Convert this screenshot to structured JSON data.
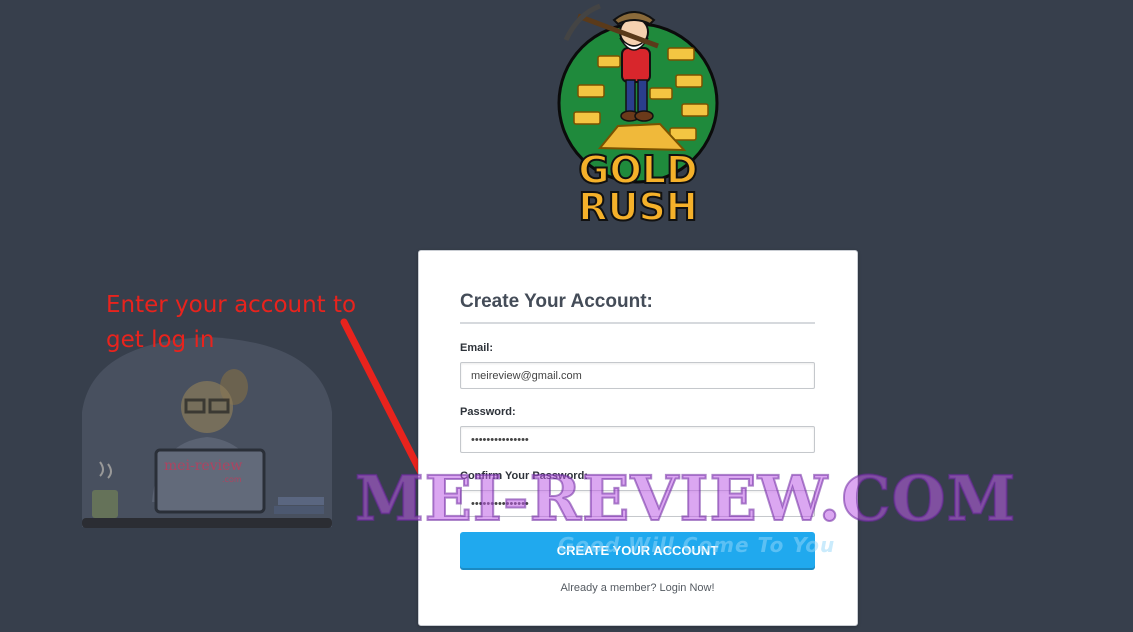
{
  "logo": {
    "line1": "GOLD",
    "line2": "RUSH"
  },
  "annotation": {
    "text": "Enter your account to get log in"
  },
  "watermark": {
    "avatar_label": "mei-review",
    "avatar_sub": ".com",
    "main": "MEI-REVIEW.COM",
    "tagline": "Good Will Come To You"
  },
  "form": {
    "title": "Create Your Account:",
    "email_label": "Email:",
    "email_value": "meireview@gmail.com",
    "password_label": "Password:",
    "password_value": "•••••••••••••••",
    "confirm_label": "Confirm Your Password:",
    "confirm_value": "•••••••••••••••",
    "submit_label": "CREATE YOUR ACCOUNT",
    "login_link": "Already a member? Login Now!"
  },
  "colors": {
    "background": "#373f4c",
    "button": "#20a9ee",
    "annotation": "#e8231d"
  }
}
